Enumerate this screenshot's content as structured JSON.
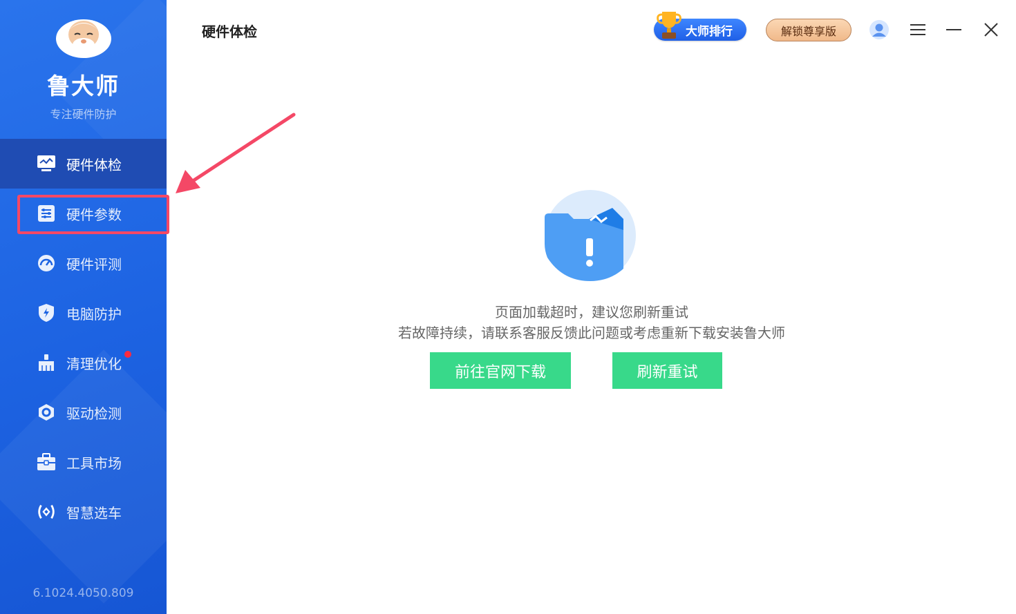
{
  "sidebar": {
    "brand": "鲁大师",
    "slogan": "专注硬件防护",
    "version": "6.1024.4050.809",
    "items": [
      {
        "label": "硬件体检",
        "icon": "monitor-icon"
      },
      {
        "label": "硬件参数",
        "icon": "parameters-list-icon"
      },
      {
        "label": "硬件评测",
        "icon": "speedometer-icon"
      },
      {
        "label": "电脑防护",
        "icon": "shield-lightning-icon"
      },
      {
        "label": "清理优化",
        "icon": "broom-icon"
      },
      {
        "label": "驱动检测",
        "icon": "hexagon-gear-icon"
      },
      {
        "label": "工具市场",
        "icon": "toolbox-icon"
      },
      {
        "label": "智慧选车",
        "icon": "car-signal-icon"
      }
    ],
    "active_index": 0,
    "highlighted_index": 1,
    "notification_dot_index": 4
  },
  "header": {
    "title": "硬件体检",
    "rank_label": "大师排行",
    "vip_label": "解锁尊享版"
  },
  "main": {
    "message_line1": "页面加载超时，建议您刷新重试",
    "message_line2": "若故障持续，请联系客服反馈此问题或考虑重新下载安装鲁大师",
    "download_button": "前往官网下载",
    "refresh_button": "刷新重试"
  },
  "colors": {
    "sidebar_blue": "#1d63e2",
    "active_item": "#1f4cb3",
    "highlight_red": "#f44866",
    "action_green": "#38d98a",
    "notification_red": "#ff2a3d"
  }
}
